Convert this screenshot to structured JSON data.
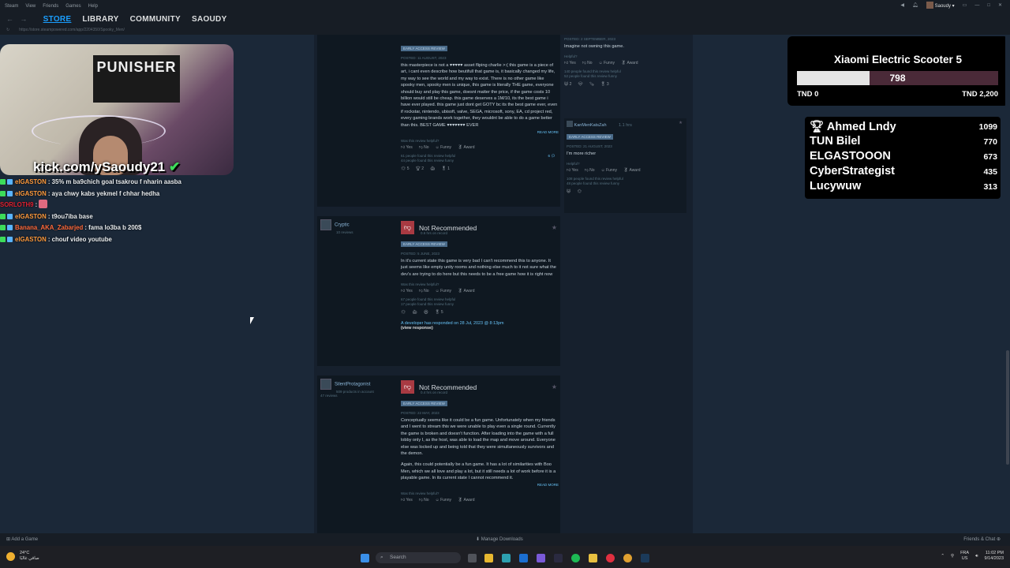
{
  "titlebar": {
    "items": [
      "Steam",
      "View",
      "Friends",
      "Games",
      "Help"
    ],
    "user": "Saoudy"
  },
  "nav": {
    "tabs": [
      "STORE",
      "LIBRARY",
      "COMMUNITY",
      "SAOUDY"
    ]
  },
  "url": "https://store.steampowered.com/app/2204350/Spooky_Men/",
  "stream": {
    "handle": "kick.com/ySaoudy21",
    "poster_text": "PUNISHER"
  },
  "chat": [
    {
      "user": "elGASTON",
      "message": "35% m ba9chich goal tsakrou f nharin aasba"
    },
    {
      "user": "elGASTON",
      "message": "aya chwy kabs yekmel f chhar hedha"
    },
    {
      "user": "SORLOTH9",
      "message": ":"
    },
    {
      "user": "elGASTON",
      "message": "t9ou7iba base"
    },
    {
      "user": "Banana_AKA_Zabarjed",
      "message": "fama lo3ba b 200$"
    },
    {
      "user": "elGASTON",
      "message": "chouf video youtube"
    }
  ],
  "goal": {
    "title": "Xiaomi Electric Scooter 5",
    "current": "798",
    "progress_fraction": 0.3627,
    "min_label": "TND 0",
    "max_label": "TND 2,200"
  },
  "leaderboard": [
    {
      "name": "Ahmed Lndy",
      "score": "1099"
    },
    {
      "name": "TUN Bilel",
      "score": "770"
    },
    {
      "name": "ELGASTOOON",
      "score": "673"
    },
    {
      "name": "CyberStrategist",
      "score": "435"
    },
    {
      "name": "Lucywuw",
      "score": "313"
    }
  ],
  "review1": {
    "badge": "EARLY ACCESS REVIEW",
    "posted": "POSTED: 11 AUGUST, 2023",
    "text": "this masterpiece is not a ♥♥♥♥♥ asset fliping charlie >:( this game is a piece of art, i cant even describe how beutifull that game is, it basically changed my life, my way to see the world and my way to exist. There is no other game like spooky men, spooky men is unique, this game is literally THE game, everyone should buy and play this game, doesnt matter the price, if the game costs 10 billion would still be cheap. this game deserves a 1M/10, its the best game i have ever played. this game just dont get GOTY bc its the best game ever, even if rockstar, nintendo, ubisoft, valve, SEGA, microsoft, sony, EA, cd project red, every gaming brands work together, they wouldnt be able to do a game better than this. BEST GAME ♥♥♥♥♥♥♥ EVER",
    "read_more": "READ MORE",
    "helpful_q": "Was this review helpful?",
    "yes": "Yes",
    "no": "No",
    "funny": "Funny",
    "award": "Award",
    "found1": "61 people found this review helpful",
    "found2": "44 people found this review funny",
    "comments": "6",
    "awards": [
      "5",
      "2",
      "",
      "1"
    ]
  },
  "review2": {
    "user": "Cryptic",
    "user_sub": "10 reviews",
    "verdict": "Not Recommended",
    "hours": "0.6 hrs on record",
    "badge": "EARLY ACCESS REVIEW",
    "posted": "POSTED: 5 JUNE, 2023",
    "text": "In it's current state this game is very bad I can't recommend this to anyone. It just seems like empty unity rooms and nothing else much to it not sure what the dev's are trying to do here but this needs to be a free game how it is right now",
    "helpful_q": "Was this review helpful?",
    "yes": "Yes",
    "no": "No",
    "funny": "Funny",
    "award": "Award",
    "found1": "67 people found this review helpful",
    "found2": "17 people found this review funny",
    "awards": [
      "",
      "",
      "",
      "5"
    ],
    "dev_response": "A developer has responded on 28 Jul, 2023 @ 8:13pm",
    "view_response": "(view response)"
  },
  "review3": {
    "user": "SilentProtagonist",
    "user_sub": "509 products in account",
    "user_reviews": "47 reviews",
    "verdict": "Not Recommended",
    "hours": "0.4 hrs on record",
    "badge": "EARLY ACCESS REVIEW",
    "posted": "POSTED: 22 MAY, 2023",
    "text": "Conceptually seems like it could be a fun game. Unfortunately when my friends and I went to stream this we were unable to play even a single round. Currently the game is broken and doesn't function. After loading into the game with a full lobby only I, as the host, was able to load the map and move around. Everyone else was locked up and being told that they were simultaneously survivors and the demon.",
    "text2": "Again, this could potentially be a fun game. It has a lot of similarities with Boo Men, which we all love and play a lot, but it still needs a lot of work before it is a playable game. In its current state I cannot recommend it.",
    "read_more": "READ MORE",
    "helpful_q": "Was this review helpful?",
    "yes": "Yes",
    "no": "No",
    "funny": "Funny",
    "award": "Award"
  },
  "side1": {
    "posted": "POSTED: 2 SEPTEMBER, 2023",
    "text": "Imagine not owning this game.",
    "helpful_q": "Helpful?",
    "yes": "Yes",
    "no": "No",
    "funny": "Funny",
    "award": "Award",
    "found1": "140 people found this review helpful",
    "found2": "52 people found this review funny",
    "awards": [
      "2",
      "",
      "",
      "3"
    ]
  },
  "side2": {
    "user": "KanMenKatsZah",
    "hours": "1.1 hrs",
    "badge": "EARLY ACCESS REVIEW",
    "posted": "POSTED: 21 AUGUST, 2023",
    "text": "I'm more richer",
    "helpful_q": "Helpful?",
    "yes": "Yes",
    "no": "No",
    "funny": "Funny",
    "award": "Award",
    "found1": "108 people found this review helpful",
    "found2": "48 people found this review funny"
  },
  "bottombar": {
    "add_game": "Add a Game",
    "manage_downloads": "Manage Downloads",
    "friends_chat": "Friends & Chat"
  },
  "taskbar": {
    "weather_temp": "24°C",
    "weather_desc": "صافي غالبًا",
    "search": "Search",
    "lang": "FRA",
    "region": "US",
    "time": "11:02 PM",
    "date": "9/14/2023"
  }
}
